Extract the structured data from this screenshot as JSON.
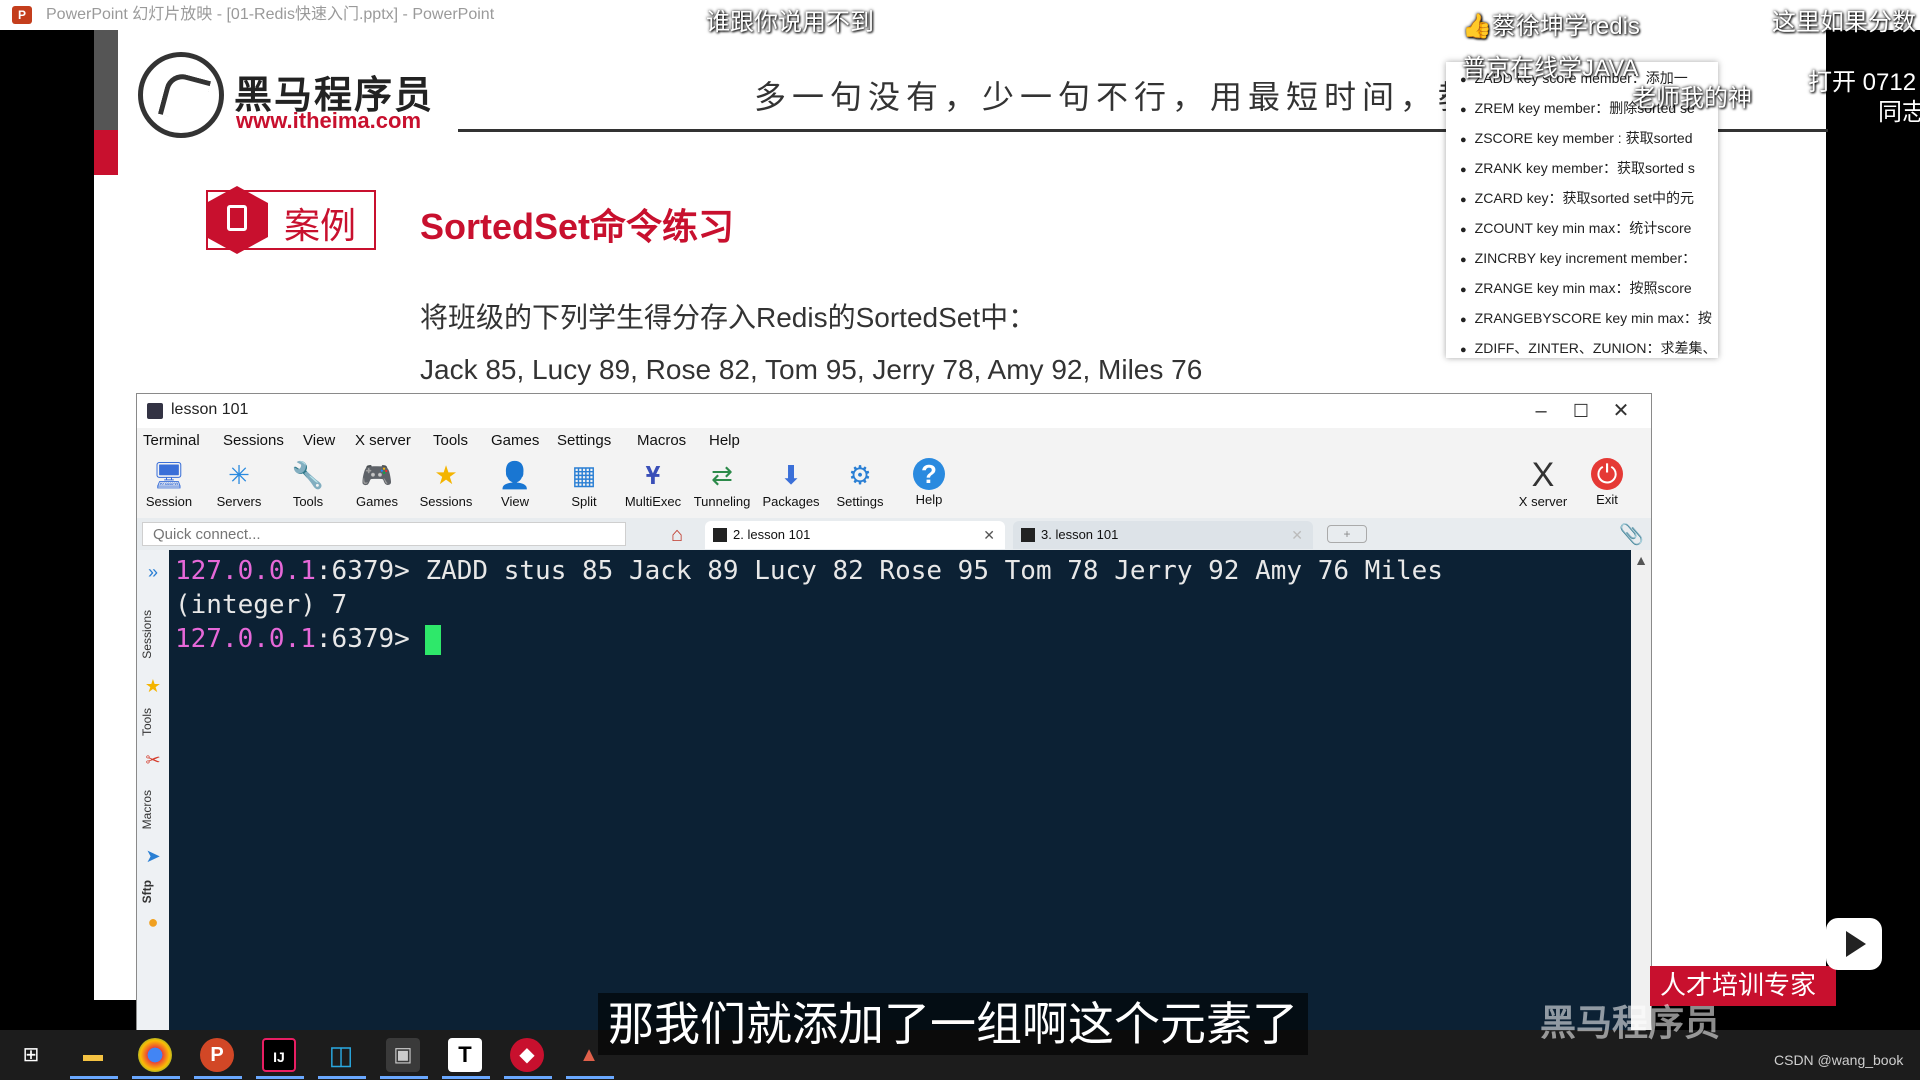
{
  "powerpoint": {
    "icon_letter": "P",
    "title": "PowerPoint 幻灯片放映 - [01-Redis快速入门.pptx] - PowerPoint"
  },
  "slide": {
    "logo_cn": "黑马程序员",
    "logo_url": "www.itheima.com",
    "slogan": "多一句没有，少一句不行，用最短时间，教",
    "case_label": "案例",
    "case_title": "SortedSet命令练习",
    "instruction": "将班级的下列学生得分存入Redis的SortedSet中：",
    "students": "Jack 85, Lucy 89, Rose 82, Tom 95, Jerry 78, Amy 92, Miles 76",
    "commands": [
      "ZADD key score member：添加一",
      "ZREM key member：删除sorted se",
      "ZSCORE key member : 获取sorted",
      "ZRANK key member：获取sorted s",
      "ZCARD key：获取sorted set中的元",
      "ZCOUNT key min max：统计score",
      "ZINCRBY key increment member：",
      "ZRANGE key min max：按照score",
      "ZRANGEBYSCORE key min max：按",
      "ZDIFF、ZINTER、ZUNION：求差集、"
    ],
    "red_banner": "人才培训专家",
    "brand_watermark": "黑马程序员"
  },
  "danmu": [
    "谁跟你说用不到",
    "👍蔡徐坤学redis",
    "这里如果分数",
    "普京在线学JAVA",
    "老师我的神",
    "打开 0712",
    "同志"
  ],
  "window": {
    "title": "lesson 101",
    "controls": {
      "minimize": "–",
      "maximize": "☐",
      "close": "✕"
    },
    "menu": [
      "Terminal",
      "Sessions",
      "View",
      "X server",
      "Tools",
      "Games",
      "Settings",
      "Macros",
      "Help"
    ],
    "toolbar": [
      {
        "label": "Session",
        "icon": "session-icon",
        "glyph": "🖥"
      },
      {
        "label": "Servers",
        "icon": "servers-icon",
        "glyph": "✳"
      },
      {
        "label": "Tools",
        "icon": "tools-icon",
        "glyph": "🔧"
      },
      {
        "label": "Games",
        "icon": "games-icon",
        "glyph": "🎮"
      },
      {
        "label": "Sessions",
        "icon": "star-icon",
        "glyph": "★"
      },
      {
        "label": "View",
        "icon": "view-icon",
        "glyph": "👤"
      },
      {
        "label": "Split",
        "icon": "split-icon",
        "glyph": "▦"
      },
      {
        "label": "MultiExec",
        "icon": "multiexec-icon",
        "glyph": "Ұ"
      },
      {
        "label": "Tunneling",
        "icon": "tunneling-icon",
        "glyph": "⇄"
      },
      {
        "label": "Packages",
        "icon": "packages-icon",
        "glyph": "⬇"
      },
      {
        "label": "Settings",
        "icon": "settings-icon",
        "glyph": "⚙"
      },
      {
        "label": "Help",
        "icon": "help-icon",
        "glyph": "?"
      }
    ],
    "toolbar_right": [
      {
        "label": "X server",
        "icon": "xserver-icon",
        "glyph": "X"
      },
      {
        "label": "Exit",
        "icon": "exit-icon",
        "glyph": "⏻"
      }
    ],
    "quick_connect_placeholder": "Quick connect...",
    "tabs": [
      {
        "label": "2. lesson 101",
        "active": true,
        "close": "✕"
      },
      {
        "label": "3. lesson 101",
        "active": false,
        "close": "✕"
      }
    ],
    "sidebar": [
      "Sessions",
      "Tools",
      "Macros",
      "Sftp"
    ],
    "terminal": {
      "lines": [
        {
          "prompt_ip": "127.0.0.1",
          "prompt_rest": ":6379> ",
          "text": "ZADD stus 85 Jack 89 Lucy 82 Rose 95 Tom 78 Jerry 92 Amy 76 Miles"
        },
        {
          "prompt_ip": "",
          "prompt_rest": "",
          "text": "(integer) 7"
        },
        {
          "prompt_ip": "127.0.0.1",
          "prompt_rest": ":6379> ",
          "text": ""
        }
      ],
      "colors": {
        "bg": "#0c2134",
        "ip": "#e668d8",
        "cursor": "#2ee86a"
      }
    }
  },
  "subtitle": "那我们就添加了一组啊这个元素了",
  "watermark": "CSDN @wang_book"
}
